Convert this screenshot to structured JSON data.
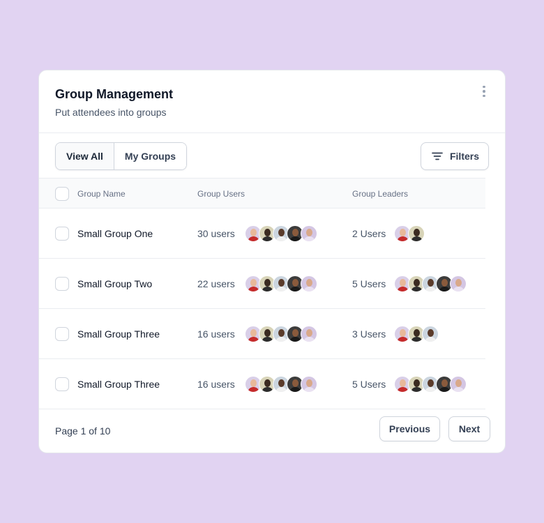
{
  "header": {
    "title": "Group Management",
    "subtitle": "Put attendees into groups",
    "menu_icon": "more-vertical-icon"
  },
  "toolbar": {
    "tabs": [
      {
        "label": "View All",
        "active": true
      },
      {
        "label": "My Groups",
        "active": false
      }
    ],
    "filters_label": "Filters",
    "filters_icon": "filter-lines-icon"
  },
  "table": {
    "columns": [
      "Group Name",
      "Group Users",
      "Group Leaders"
    ],
    "rows": [
      {
        "name": "Small Group One",
        "users": "30 users",
        "user_avatars": 5,
        "leaders": "2 Users",
        "leader_avatars": 2
      },
      {
        "name": "Small Group Two",
        "users": "22 users",
        "user_avatars": 5,
        "leaders": "5 Users",
        "leader_avatars": 5
      },
      {
        "name": "Small Group Three",
        "users": "16 users",
        "user_avatars": 5,
        "leaders": "3 Users",
        "leader_avatars": 3
      },
      {
        "name": "Small Group Three",
        "users": "16 users",
        "user_avatars": 5,
        "leaders": "5 Users",
        "leader_avatars": 5
      }
    ]
  },
  "footer": {
    "page_info": "Page 1 of 10",
    "previous_label": "Previous",
    "next_label": "Next"
  },
  "colors": {
    "background": "#E1D3F2",
    "card": "#FFFFFF",
    "border": "#D0D5DD",
    "text_primary": "#101828",
    "text_secondary": "#475467"
  }
}
